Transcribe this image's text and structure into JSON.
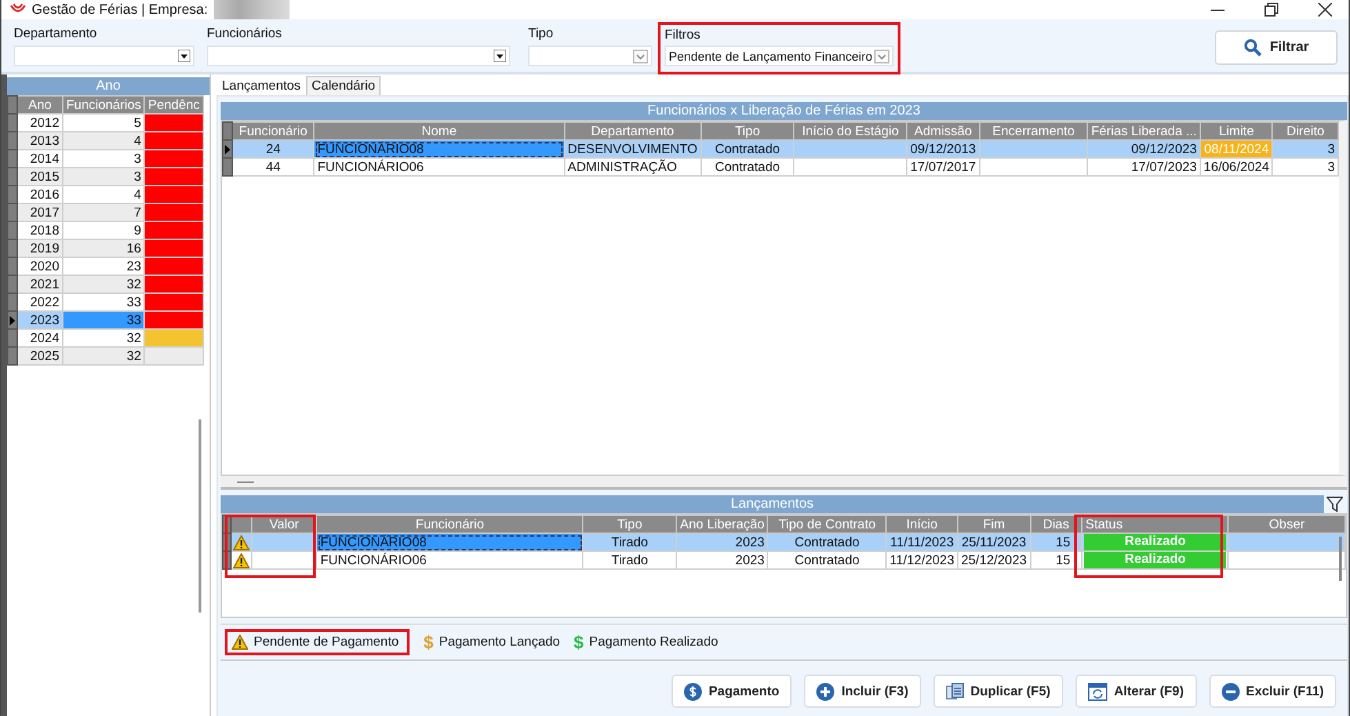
{
  "window": {
    "title": "Gestão de Férias | Empresa:"
  },
  "filters": [
    {
      "kind": "lookup",
      "label": "Departamento"
    },
    {
      "kind": "lookup",
      "label": "Funcionários"
    },
    {
      "kind": "combo",
      "label": "Tipo"
    },
    {
      "kind": "combo",
      "label": "Filtros",
      "value": "Pendente de Lançamento Financeiro",
      "highlighted": true
    }
  ],
  "filter_button": {
    "label": "Filtrar"
  },
  "year_panel": {
    "title": "Ano",
    "columns": [
      "Ano",
      "Funcionários",
      "Pendênc"
    ],
    "rows": [
      {
        "year": "2012",
        "count": "5",
        "color": "#ff0000",
        "selected": false
      },
      {
        "year": "2013",
        "count": "4",
        "color": "#ff0000",
        "selected": false
      },
      {
        "year": "2014",
        "count": "3",
        "color": "#ff0000",
        "selected": false
      },
      {
        "year": "2015",
        "count": "3",
        "color": "#ff0000",
        "selected": false
      },
      {
        "year": "2016",
        "count": "4",
        "color": "#ff0000",
        "selected": false
      },
      {
        "year": "2017",
        "count": "7",
        "color": "#ff0000",
        "selected": false
      },
      {
        "year": "2018",
        "count": "9",
        "color": "#ff0000",
        "selected": false
      },
      {
        "year": "2019",
        "count": "16",
        "color": "#ff0000",
        "selected": false
      },
      {
        "year": "2020",
        "count": "23",
        "color": "#ff0000",
        "selected": false
      },
      {
        "year": "2021",
        "count": "32",
        "color": "#ff0000",
        "selected": false
      },
      {
        "year": "2022",
        "count": "33",
        "color": "#ff0000",
        "selected": false
      },
      {
        "year": "2023",
        "count": "33",
        "color": "#ff0000",
        "selected": true
      },
      {
        "year": "2024",
        "count": "32",
        "color": "#f4c430",
        "selected": false
      },
      {
        "year": "2025",
        "count": "32",
        "selected": false
      }
    ]
  },
  "tabs": [
    {
      "label": "Lançamentos",
      "selected": true
    },
    {
      "label": "Calendário",
      "selected": false
    }
  ],
  "employees": {
    "title": "Funcionários x Liberação de Férias em 2023",
    "columns": [
      "Funcionário",
      "Nome",
      "Departamento",
      "Tipo",
      "Início do Estágio",
      "Admissão",
      "Encerramento",
      "Férias Liberada ...",
      "Limite",
      "Direito"
    ],
    "rows": [
      {
        "cells": [
          "24",
          "FUNCIONÁRIO08",
          "DESENVOLVIMENTO",
          "Contratado",
          null,
          "09/12/2013",
          null,
          "09/12/2023",
          "08/11/2024",
          "3"
        ],
        "limit_overdue": true,
        "selected": true
      },
      {
        "cells": [
          "44",
          "FUNCIONÁRIO06",
          "ADMINISTRAÇÃO",
          "Contratado",
          null,
          "17/07/2017",
          null,
          "17/07/2023",
          "16/06/2024",
          "3"
        ],
        "limit_overdue": false,
        "selected": false
      }
    ]
  },
  "launches": {
    "title": "Lançamentos",
    "columns": [
      {
        "label": "Valor",
        "highlighted": true
      },
      {
        "label": "Funcionário",
        "highlighted": false
      },
      {
        "label": "Tipo",
        "highlighted": false
      },
      {
        "label": "Ano Liberação",
        "highlighted": false
      },
      {
        "label": "Tipo de Contrato",
        "highlighted": false
      },
      {
        "label": "Início",
        "highlighted": false
      },
      {
        "label": "Fim",
        "highlighted": false
      },
      {
        "label": "Dias",
        "highlighted": false
      },
      {
        "label": "Status",
        "highlighted": true
      },
      {
        "label": "Obser",
        "highlighted": false
      }
    ],
    "rows": [
      {
        "kind": "warning",
        "cells": [
          null,
          "FUNCIONÁRIO08",
          "Tirado",
          "2023",
          "Contratado",
          "11/11/2023",
          "25/11/2023",
          "15",
          "Realizado",
          null
        ],
        "selected": true
      },
      {
        "kind": "warning",
        "cells": [
          null,
          "FUNCIONÁRIO06",
          "Tirado",
          "2023",
          "Contratado",
          "11/12/2023",
          "25/12/2023",
          "15",
          "Realizado",
          null
        ],
        "selected": false
      }
    ]
  },
  "legend": [
    {
      "kind": "warning",
      "label": "Pendente de Pagamento",
      "highlighted": true
    },
    {
      "kind": "symbol",
      "symbol": "$",
      "color": "#e0a030",
      "label": "Pagamento Lançado",
      "highlighted": false
    },
    {
      "kind": "symbol",
      "symbol": "$",
      "color": "#22bb44",
      "label": "Pagamento Realizado",
      "highlighted": false
    }
  ],
  "actions": [
    {
      "kind": "payment",
      "label": "Pagamento"
    },
    {
      "kind": "add",
      "label": "Incluir (F3)"
    },
    {
      "kind": "duplicate",
      "label": "Duplicar (F5)"
    },
    {
      "kind": "edit",
      "label": "Alterar (F9)"
    },
    {
      "kind": "delete",
      "label": "Excluir (F11)"
    }
  ]
}
